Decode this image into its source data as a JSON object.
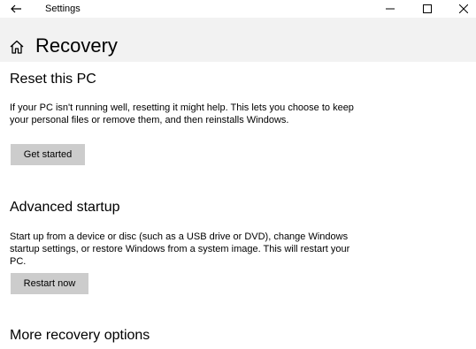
{
  "window": {
    "title": "Settings"
  },
  "page": {
    "title": "Recovery"
  },
  "sections": [
    {
      "title": "Reset this PC",
      "description": "If your PC isn't running well, resetting it might help. This lets you choose to keep your personal files or remove them, and then reinstalls Windows.",
      "button_label": "Get started"
    },
    {
      "title": "Advanced startup",
      "description": "Start up from a device or disc (such as a USB drive or DVD), change Windows startup settings, or restore Windows from a system image. This will restart your PC.",
      "button_label": "Restart now"
    },
    {
      "title": "More recovery options"
    }
  ],
  "icons": {
    "back": "back-arrow-icon",
    "minimize": "minimize-icon",
    "maximize": "maximize-icon",
    "close": "close-icon",
    "home": "home-icon"
  },
  "colors": {
    "header_background": "#f2f2f2",
    "button_background": "#cccccc",
    "page_background": "#ffffff"
  }
}
